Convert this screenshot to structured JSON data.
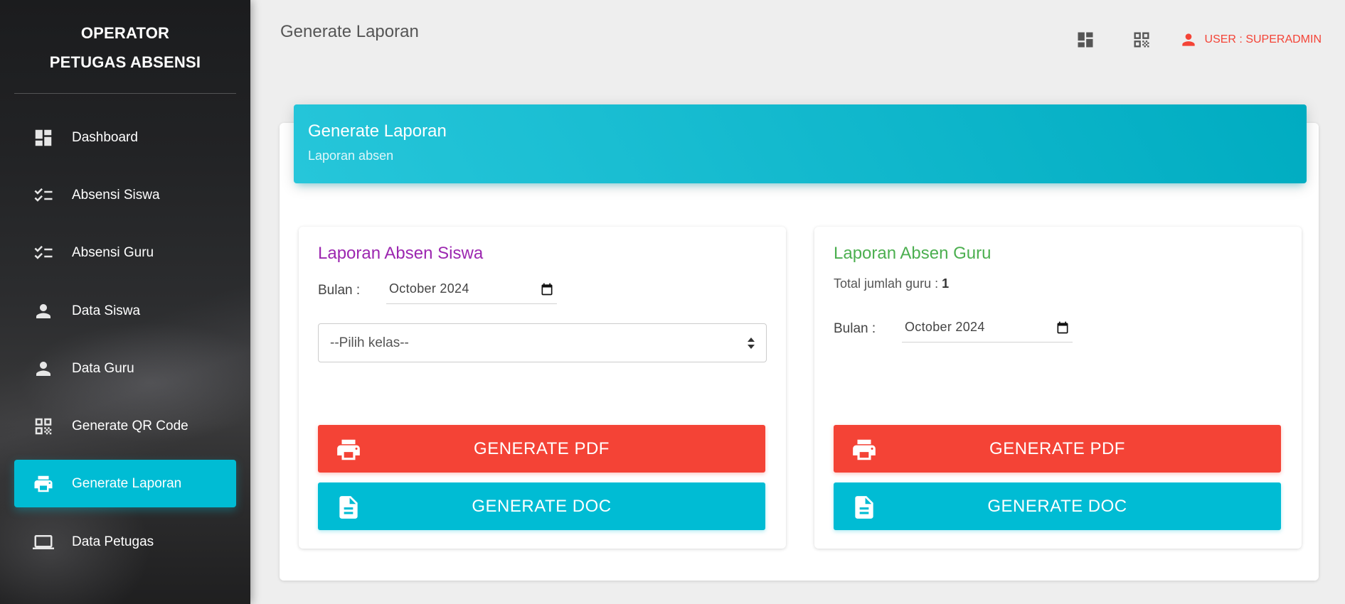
{
  "sidebar": {
    "brand_line1": "OPERATOR",
    "brand_line2": "PETUGAS ABSENSI",
    "items": [
      {
        "label": "Dashboard",
        "icon": "dashboard-icon",
        "active": false
      },
      {
        "label": "Absensi Siswa",
        "icon": "checklist-icon",
        "active": false
      },
      {
        "label": "Absensi Guru",
        "icon": "checklist-icon",
        "active": false
      },
      {
        "label": "Data Siswa",
        "icon": "person-icon",
        "active": false
      },
      {
        "label": "Data Guru",
        "icon": "person-icon",
        "active": false
      },
      {
        "label": "Generate QR Code",
        "icon": "qr-code-icon",
        "active": false
      },
      {
        "label": "Generate Laporan",
        "icon": "print-icon",
        "active": true
      },
      {
        "label": "Data Petugas",
        "icon": "laptop-icon",
        "active": false
      }
    ]
  },
  "header": {
    "title": "Generate Laporan",
    "user_label": "USER : SUPERADMIN",
    "accent_color": "#f44336"
  },
  "card": {
    "title": "Generate Laporan",
    "subtitle": "Laporan absen",
    "header_color": "#00bcd4"
  },
  "siswa": {
    "title": "Laporan Absen Siswa",
    "bulan_label": "Bulan :",
    "bulan_value": "October 2024",
    "kelas_placeholder": "--Pilih kelas--",
    "pdf_label": "GENERATE PDF",
    "doc_label": "GENERATE DOC"
  },
  "guru": {
    "title": "Laporan Absen Guru",
    "total_label": "Total jumlah guru : ",
    "total_value": "1",
    "bulan_label": "Bulan :",
    "bulan_value": "October 2024",
    "pdf_label": "GENERATE PDF",
    "doc_label": "GENERATE DOC"
  }
}
